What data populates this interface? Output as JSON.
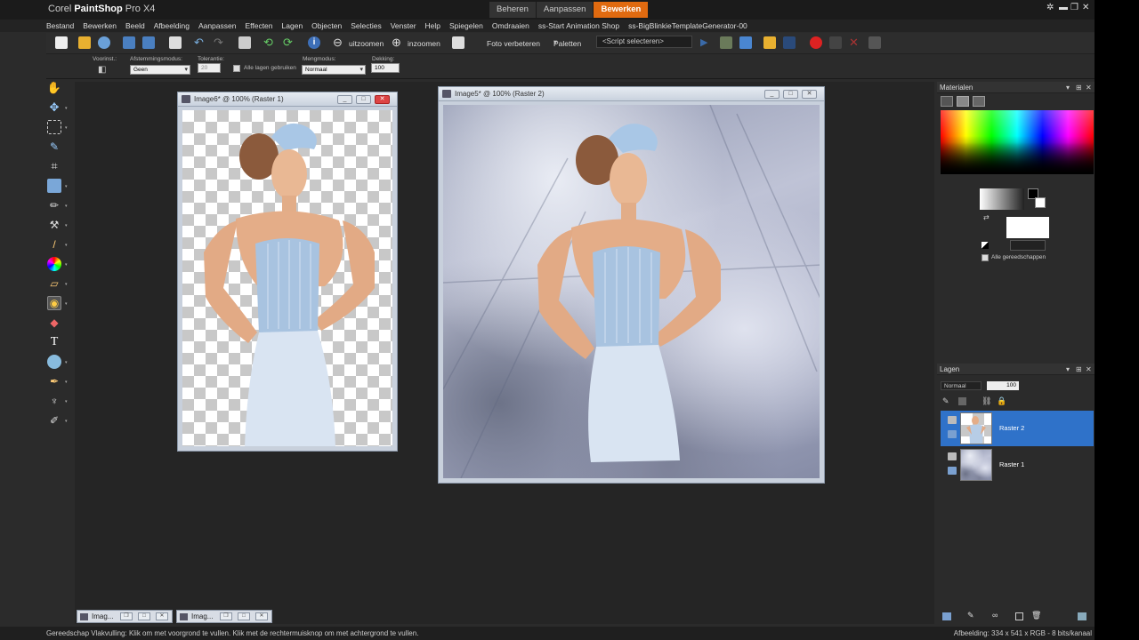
{
  "app": {
    "title_prefix": "Corel ",
    "title_brand": "PaintShop",
    "title_suffix": " Pro X4"
  },
  "workspace_tabs": [
    {
      "label": "Beheren",
      "active": false
    },
    {
      "label": "Aanpassen",
      "active": false
    },
    {
      "label": "Bewerken",
      "active": true
    }
  ],
  "menu": [
    "Bestand",
    "Bewerken",
    "Beeld",
    "Afbeelding",
    "Aanpassen",
    "Effecten",
    "Lagen",
    "Objecten",
    "Selecties",
    "Venster",
    "Help",
    "Spiegelen",
    "Omdraaien",
    "ss-Start Animation Shop",
    "ss-BigBlinkieTemplateGenerator-00"
  ],
  "toolbar": {
    "zoom_out": "uitzoomen",
    "zoom_in": "inzoomen",
    "photo_enhance": "Foto verbeteren",
    "palettes": "Paletten",
    "script_select": "<Script selecteren>"
  },
  "tool_options": {
    "preset_label": "Voorinst.:",
    "match_mode_label": "Afstemmingsmodus:",
    "match_mode_value": "Geen",
    "tolerance_label": "Tolerantie:",
    "tolerance_value": "20",
    "all_layers_label": "Alle lagen gebruiken",
    "blend_mode_label": "Mengmodus:",
    "blend_mode_value": "Normaal",
    "opacity_label": "Dekking:",
    "opacity_value": "100"
  },
  "documents": [
    {
      "title": "Image6* @ 100% (Raster 1)"
    },
    {
      "title": "Image5* @ 100% (Raster 2)"
    }
  ],
  "minimized": [
    {
      "label": "Imag..."
    },
    {
      "label": "Imag..."
    }
  ],
  "materials": {
    "title": "Materialen",
    "all_tools": "Alle gereedschappen"
  },
  "layers": {
    "title": "Lagen",
    "blend": "Normaal",
    "opacity": "100",
    "items": [
      {
        "name": "Raster 2",
        "active": true
      },
      {
        "name": "Raster 1",
        "active": false
      }
    ]
  },
  "status": {
    "left": "Gereedschap Vlakvulling: Klik om met voorgrond te vullen. Klik met de rechtermuisknop om met achtergrond te vullen.",
    "right": "Afbeelding: 334 x 541 x RGB - 8 bits/kanaal"
  },
  "colors": {
    "accent_tab": "#e06a10",
    "selected_layer": "#2f72c9"
  }
}
